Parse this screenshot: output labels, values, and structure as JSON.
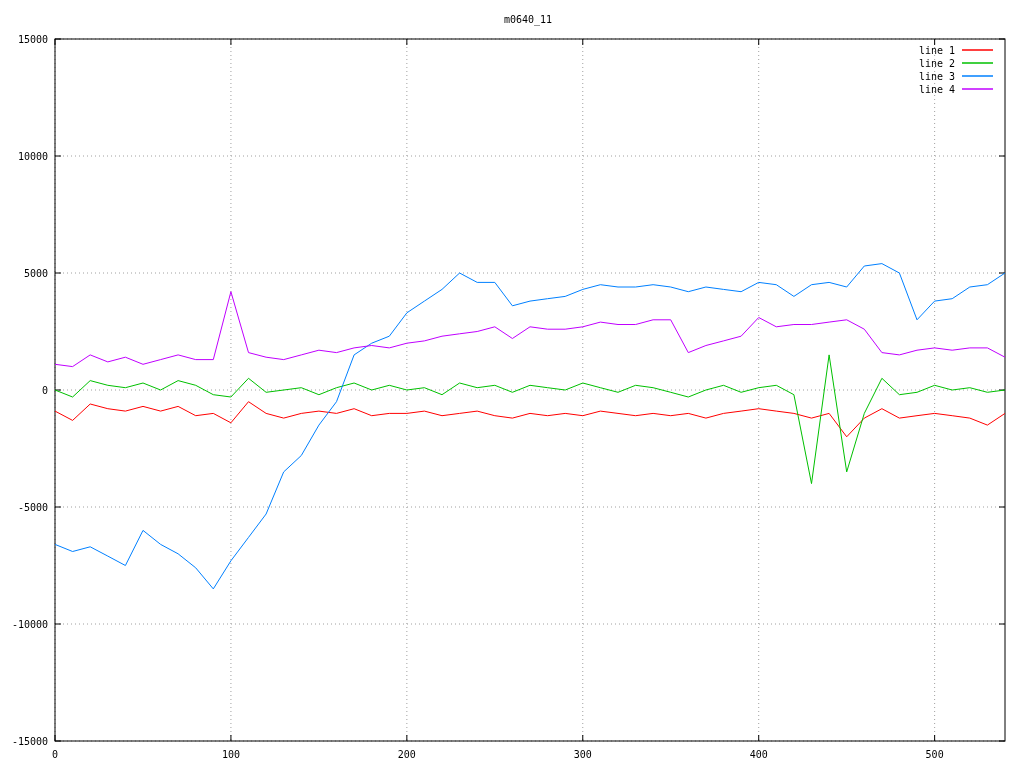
{
  "chart_data": {
    "type": "line",
    "title": "m0640_11",
    "x": [
      0,
      10,
      20,
      30,
      40,
      50,
      60,
      70,
      80,
      90,
      100,
      110,
      120,
      130,
      140,
      150,
      160,
      170,
      180,
      190,
      200,
      210,
      220,
      230,
      240,
      250,
      260,
      270,
      280,
      290,
      300,
      310,
      320,
      330,
      340,
      350,
      360,
      370,
      380,
      390,
      400,
      410,
      420,
      430,
      440,
      450,
      460,
      470,
      480,
      490,
      500,
      510,
      520,
      530,
      540
    ],
    "series": [
      {
        "name": "line 1",
        "color": "#ff0000",
        "values": [
          -900,
          -1300,
          -600,
          -800,
          -900,
          -700,
          -900,
          -700,
          -1100,
          -1000,
          -1400,
          -500,
          -1000,
          -1200,
          -1000,
          -900,
          -1000,
          -800,
          -1100,
          -1000,
          -1000,
          -900,
          -1100,
          -1000,
          -900,
          -1100,
          -1200,
          -1000,
          -1100,
          -1000,
          -1100,
          -900,
          -1000,
          -1100,
          -1000,
          -1100,
          -1000,
          -1200,
          -1000,
          -900,
          -800,
          -900,
          -1000,
          -1200,
          -1000,
          -2000,
          -1200,
          -800,
          -1200,
          -1100,
          -1000,
          -1100,
          -1200,
          -1500,
          -1000
        ]
      },
      {
        "name": "line 2",
        "color": "#00c000",
        "values": [
          0,
          -300,
          400,
          200,
          100,
          300,
          0,
          400,
          200,
          -200,
          -300,
          500,
          -100,
          0,
          100,
          -200,
          100,
          300,
          0,
          200,
          0,
          100,
          -200,
          300,
          100,
          200,
          -100,
          200,
          100,
          0,
          300,
          100,
          -100,
          200,
          100,
          -100,
          -300,
          0,
          200,
          -100,
          100,
          200,
          -200,
          -4000,
          1500,
          -3500,
          -1000,
          500,
          -200,
          -100,
          200,
          0,
          100,
          -100,
          0
        ]
      },
      {
        "name": "line 3",
        "color": "#0080ff",
        "values": [
          -6600,
          -6900,
          -6700,
          -7100,
          -7500,
          -6000,
          -6600,
          -7000,
          -7600,
          -8500,
          -7300,
          -6300,
          -5300,
          -3500,
          -2800,
          -1500,
          -500,
          1500,
          2000,
          2300,
          3300,
          3800,
          4300,
          5000,
          4600,
          4600,
          3600,
          3800,
          3900,
          4000,
          4300,
          4500,
          4400,
          4400,
          4500,
          4400,
          4200,
          4400,
          4300,
          4200,
          4600,
          4500,
          4000,
          4500,
          4600,
          4400,
          5300,
          5400,
          5000,
          3000,
          3800,
          3900,
          4400,
          4500,
          5000
        ]
      },
      {
        "name": "line 4",
        "color": "#c000ff",
        "values": [
          1100,
          1000,
          1500,
          1200,
          1400,
          1100,
          1300,
          1500,
          1300,
          1300,
          4200,
          1600,
          1400,
          1300,
          1500,
          1700,
          1600,
          1800,
          1900,
          1800,
          2000,
          2100,
          2300,
          2400,
          2500,
          2700,
          2200,
          2700,
          2600,
          2600,
          2700,
          2900,
          2800,
          2800,
          3000,
          3000,
          1600,
          1900,
          2100,
          2300,
          3100,
          2700,
          2800,
          2800,
          2900,
          3000,
          2600,
          1600,
          1500,
          1700,
          1800,
          1700,
          1800,
          1800,
          1400
        ]
      }
    ],
    "xlim": [
      0,
      540
    ],
    "ylim": [
      -15000,
      15000
    ],
    "xticks": [
      0,
      100,
      200,
      300,
      400,
      500
    ],
    "yticks": [
      -15000,
      -10000,
      -5000,
      0,
      5000,
      10000,
      15000
    ],
    "grid": true,
    "legend": true
  }
}
